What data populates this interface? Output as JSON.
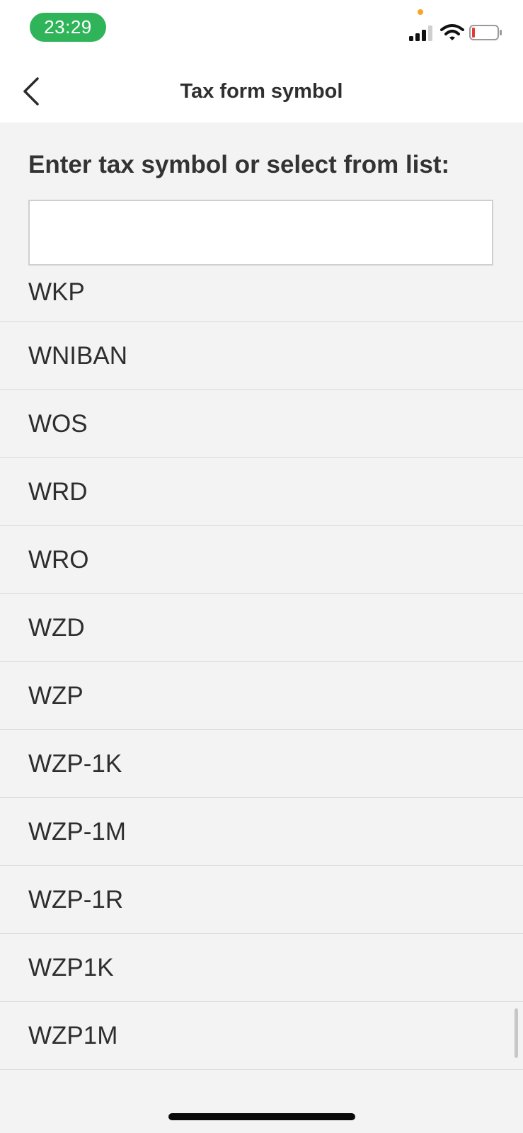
{
  "status_bar": {
    "time": "23:29",
    "accent": "#30b45a",
    "icons": [
      "signal-icon",
      "wifi-icon",
      "battery-icon"
    ]
  },
  "navbar": {
    "title": "Tax form symbol",
    "back_icon": "chevron-left-icon"
  },
  "prompt": "Enter tax symbol or select from list:",
  "search": {
    "value": "",
    "placeholder": ""
  },
  "list": {
    "items": [
      {
        "label": "WKP"
      },
      {
        "label": "WNIBAN"
      },
      {
        "label": "WOS"
      },
      {
        "label": "WRD"
      },
      {
        "label": "WRO"
      },
      {
        "label": "WZD"
      },
      {
        "label": "WZP"
      },
      {
        "label": "WZP-1K"
      },
      {
        "label": "WZP-1M"
      },
      {
        "label": "WZP-1R"
      },
      {
        "label": "WZP1K"
      },
      {
        "label": "WZP1M"
      }
    ]
  }
}
